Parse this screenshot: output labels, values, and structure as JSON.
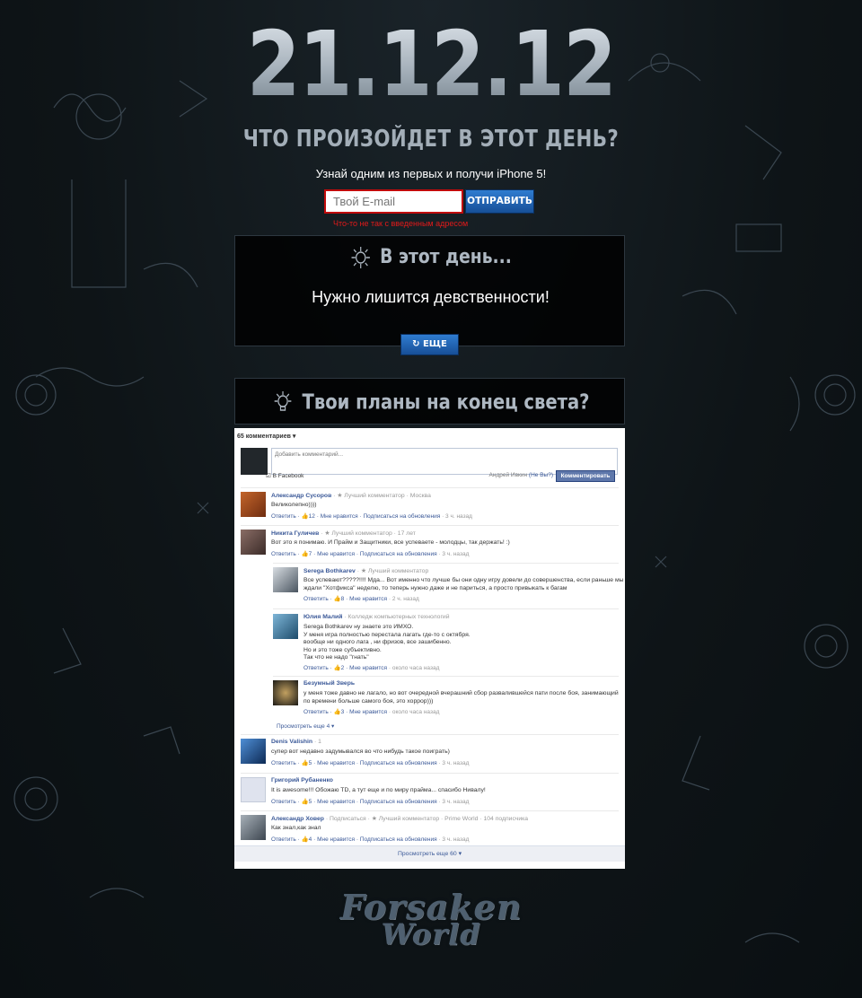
{
  "hero": {
    "date": "21.12.12",
    "question": "ЧТО ПРОИЗОЙДЕТ В ЭТОТ ДЕНЬ?",
    "promo": "Узнай одним из первых и получи iPhone 5!"
  },
  "signup": {
    "email_placeholder": "Твой E-mail",
    "send_label": "ОТПРАВИТЬ",
    "error": "Что-то не так с введенным адресом"
  },
  "fact_panel": {
    "title": "В этот день...",
    "fact": "Нужно лишится девственности!",
    "more_label": "ЕЩЕ"
  },
  "plans_panel": {
    "title": "Твои планы на конец света?"
  },
  "fb": {
    "count": "65 комментариев",
    "compose_placeholder": "Добавить комментарий...",
    "facebook_check": "В Facebook",
    "user_name": "Андрей Ивкин",
    "not_you": "(Не Вы?)",
    "post_label": "Комментировать",
    "comments": [
      {
        "name": "Александр Сусоров",
        "meta": "· ★ Лучший комментатор · Москва",
        "body": "Великолепно))))",
        "likes": "12",
        "time": "· 3 ч. назад"
      },
      {
        "name": "Никита Гуличев",
        "meta": "· ★ Лучший комментатор · 17 лет",
        "body": "Вот это я понимаю. И Прайм и Защитники, все успеваете - молодцы, так держать! :)",
        "likes": "7",
        "time": "· 3 ч. назад"
      },
      {
        "name": "Denis Valishin",
        "meta": "· 1",
        "body": "супер вот недавно задумывался во что нибудь такое поиграть)",
        "likes": "5",
        "time": "· 3 ч. назад"
      },
      {
        "name": "Григорий Рубаненко",
        "meta": "",
        "body": "It is awesome!!! Обожаю TD, а тут еще и по миру прайма... спасибо Нивалу!",
        "likes": "5",
        "time": "· 3 ч. назад"
      },
      {
        "name": "Александр Ховер",
        "meta": "· Подписаться · ★ Лучший комментатор · Prime World · 104 подписчика",
        "body": "Как знал,как знал",
        "likes": "4",
        "time": "· 3 ч. назад"
      }
    ],
    "replies": [
      {
        "name": "Serega Bothkarev",
        "meta": "· ★ Лучший комментатор",
        "body1": "Все успевают?????!!!! Мда... Вот именно что лучше бы они одну игру довели до совершенства, если раньше мы",
        "body2": "ждали \"Хотфикса\" неделю, то теперь нужно даже и не париться, а просто привыкать к багам",
        "likes": "8",
        "time": "· 2 ч. назад"
      },
      {
        "name": "Юлия Малий",
        "meta": "· Колледж компьютерных технологий",
        "body1": "Serega Bothkarev ну знаете это ИМХО.",
        "body2": "У меня игра полностью перестала лагать где-то с октября.",
        "body3": "вообще ни одного лага , ни фризов, все зашибенно.",
        "body4": "Но и это тоже субъективно.",
        "body5": "Так что не надо \"гнать\"",
        "likes": "2",
        "time": "· около часа назад"
      },
      {
        "name": "Безумный Зверь",
        "meta": "",
        "body1": "у меня тоже давно не лагало, но вот очередной вчерашний сбор развалившейся пати после боя, занимающий",
        "body2": "по времени больше самого боя, это хоррор)))",
        "likes": "3",
        "time": "· около часа назад"
      }
    ],
    "reply_label": "Ответить",
    "like_label": "Мне нравится",
    "subscribe_label": "Подписаться на обновления",
    "view_more_replies": "Просмотреть еще 4 ▾",
    "view_more": "Просмотреть еще 60 ▾"
  },
  "logo": {
    "line1": "Forsaken",
    "line2": "World"
  },
  "colors": {
    "accent_blue": "#1f5fb0",
    "error_red": "#e21a1a",
    "fb_link": "#3b5998"
  }
}
